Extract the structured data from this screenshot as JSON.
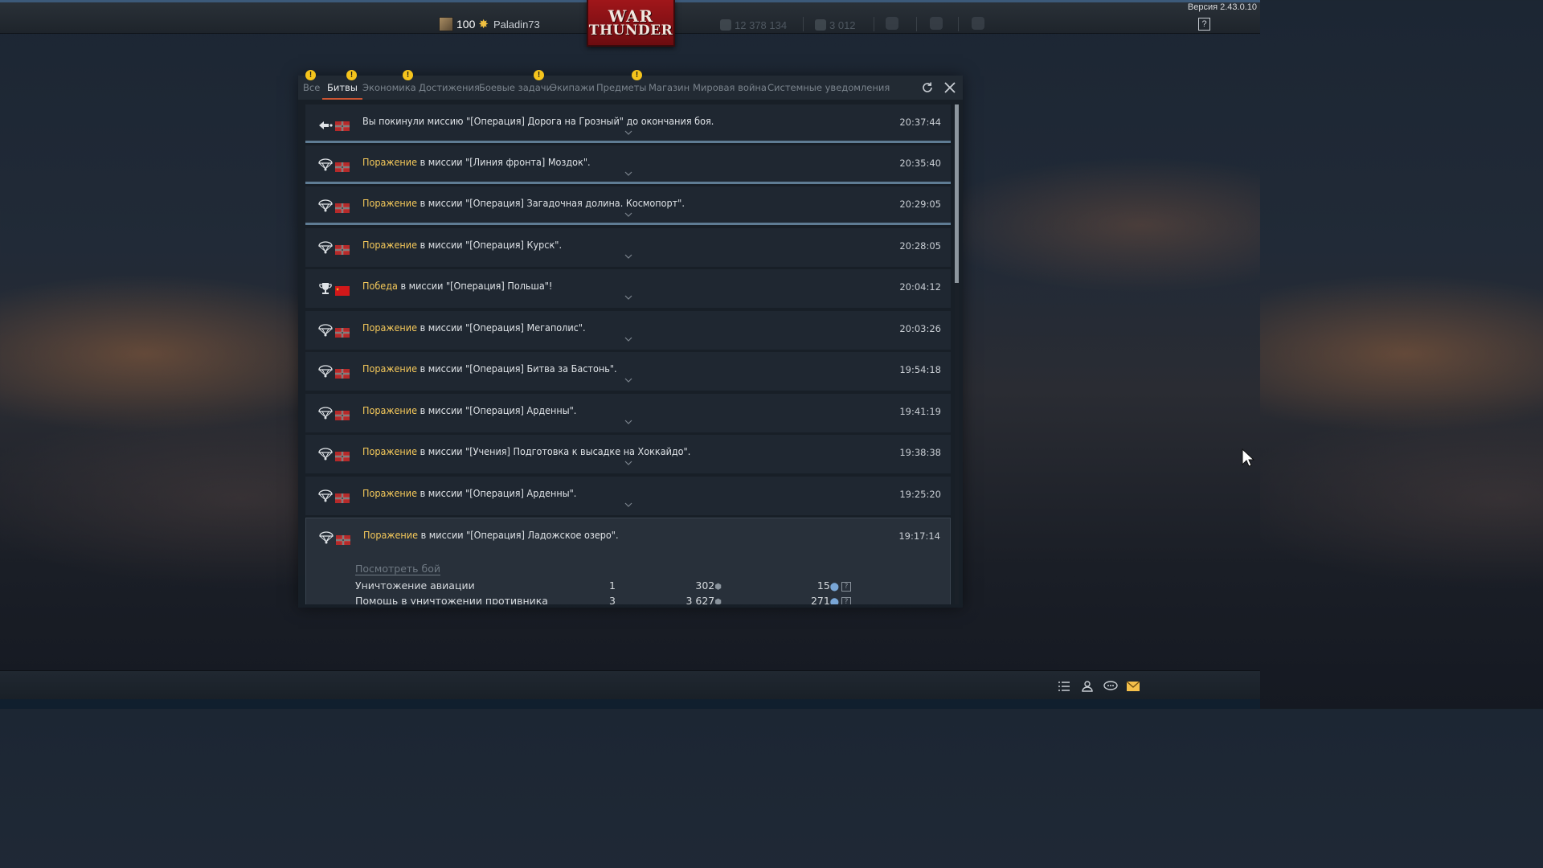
{
  "app": {
    "version": "Версия 2.43.0.10",
    "logo_line1": "WAR",
    "logo_line2": "THUNDER"
  },
  "player": {
    "level": "100",
    "nickname": "Paladin73"
  },
  "currencies": {
    "silver_lions": "12 378 134",
    "research": "3 012"
  },
  "tabs": [
    {
      "label": "Все",
      "badge": "!"
    },
    {
      "label": "Битвы",
      "badge": "!"
    },
    {
      "label": "Экономика",
      "badge": "!"
    },
    {
      "label": "Достижения",
      "badge": ""
    },
    {
      "label": "Боевые задачи",
      "badge": "!"
    },
    {
      "label": "Экипажи",
      "badge": ""
    },
    {
      "label": "Предметы",
      "badge": "!"
    },
    {
      "label": "Магазин",
      "badge": ""
    },
    {
      "label": "Мировая война",
      "badge": ""
    },
    {
      "label": "Системные уведомления",
      "badge": ""
    }
  ],
  "active_tab": "Битвы",
  "colors": {
    "accent_tab": "#cc5533",
    "status_text": "#f4c85a",
    "badge": "#f5c41c",
    "separator": "#5f7c94"
  },
  "messages": [
    {
      "icon": "exit-icon",
      "flag": "germany",
      "prefix": "",
      "text": "Вы покинули миссию \"[Операция] Дорога на Грозный\" до окончания боя.",
      "time": "20:37:44"
    },
    {
      "icon": "parachute-icon",
      "flag": "germany",
      "prefix": "Поражение",
      "text": " в миссии \"[Линия фронта] Моздок\".",
      "time": "20:35:40"
    },
    {
      "icon": "parachute-icon",
      "flag": "germany",
      "prefix": "Поражение",
      "text": " в миссии \"[Операция] Загадочная долина. Космопорт\".",
      "time": "20:29:05"
    },
    {
      "icon": "parachute-icon",
      "flag": "germany",
      "prefix": "Поражение",
      "text": " в миссии \"[Операция] Курск\".",
      "time": "20:28:05"
    },
    {
      "icon": "trophy-icon",
      "flag": "ussr",
      "prefix": "Победа",
      "text": " в миссии \"[Операция] Польша\"!",
      "time": "20:04:12"
    },
    {
      "icon": "parachute-icon",
      "flag": "germany",
      "prefix": "Поражение",
      "text": " в миссии \"[Операция] Мегаполис\".",
      "time": "20:03:26"
    },
    {
      "icon": "parachute-icon",
      "flag": "germany",
      "prefix": "Поражение",
      "text": " в миссии \"[Операция] Битва за Бастонь\".",
      "time": "19:54:18"
    },
    {
      "icon": "parachute-icon",
      "flag": "germany",
      "prefix": "Поражение",
      "text": " в миссии \"[Операция] Арденны\".",
      "time": "19:41:19"
    },
    {
      "icon": "parachute-icon",
      "flag": "germany",
      "prefix": "Поражение",
      "text": " в миссии \"[Учения] Подготовка к высадке на Хоккайдо\".",
      "time": "19:38:38"
    },
    {
      "icon": "parachute-icon",
      "flag": "germany",
      "prefix": "Поражение",
      "text": " в миссии \"[Операция] Арденны\".",
      "time": "19:25:20"
    },
    {
      "icon": "parachute-icon",
      "flag": "germany",
      "prefix": "Поражение",
      "text": " в миссии \"[Операция] Ладожское озеро\".",
      "time": "19:17:14"
    }
  ],
  "expanded": {
    "view_battle": "Посмотреть бой",
    "stats": [
      {
        "name": "Уничтожение авиации",
        "count": "1",
        "silver": "302",
        "rp": "15"
      },
      {
        "name": "Помощь в уничтожении противника",
        "count": "3",
        "silver": "3 627",
        "rp": "271"
      }
    ]
  },
  "bottom_icons": [
    "list-icon",
    "squad-icon",
    "chat-icon",
    "mail-icon"
  ]
}
